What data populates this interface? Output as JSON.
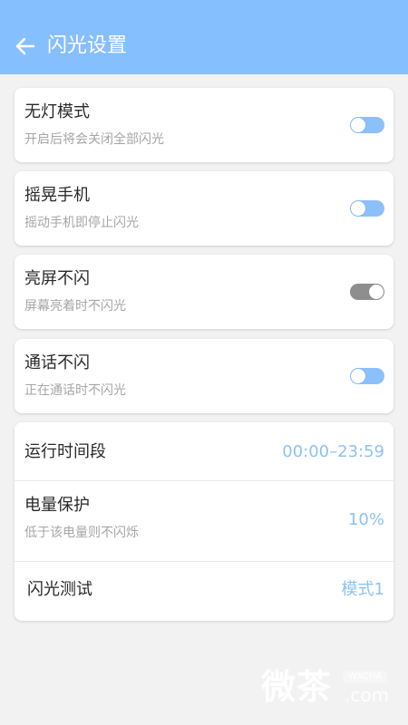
{
  "header": {
    "title": "闪光设置"
  },
  "toggles": [
    {
      "label": "无灯模式",
      "sub": "开启后将会关闭全部闪光",
      "on": false
    },
    {
      "label": "摇晃手机",
      "sub": "摇动手机即停止闪光",
      "on": false
    },
    {
      "label": "亮屏不闪",
      "sub": "屏幕亮着时不闪光",
      "on": true
    },
    {
      "label": "通话不闪",
      "sub": "正在通话时不闪光",
      "on": false
    }
  ],
  "settings": {
    "time": {
      "label": "运行时间段",
      "value": "00:00–23:59"
    },
    "battery": {
      "label": "电量保护",
      "sub": "低于该电量则不闪烁",
      "value": "10%"
    },
    "test": {
      "label": "闪光测试",
      "value": "模式1"
    }
  },
  "watermark": {
    "cn": "微茶",
    "badge": "WXCHA",
    "com": ".com"
  },
  "colors": {
    "appbar": "#86bffd",
    "toggle_off": "#8cc0fb",
    "toggle_on": "#8e8e8e",
    "value_text": "#8dc3f2"
  }
}
